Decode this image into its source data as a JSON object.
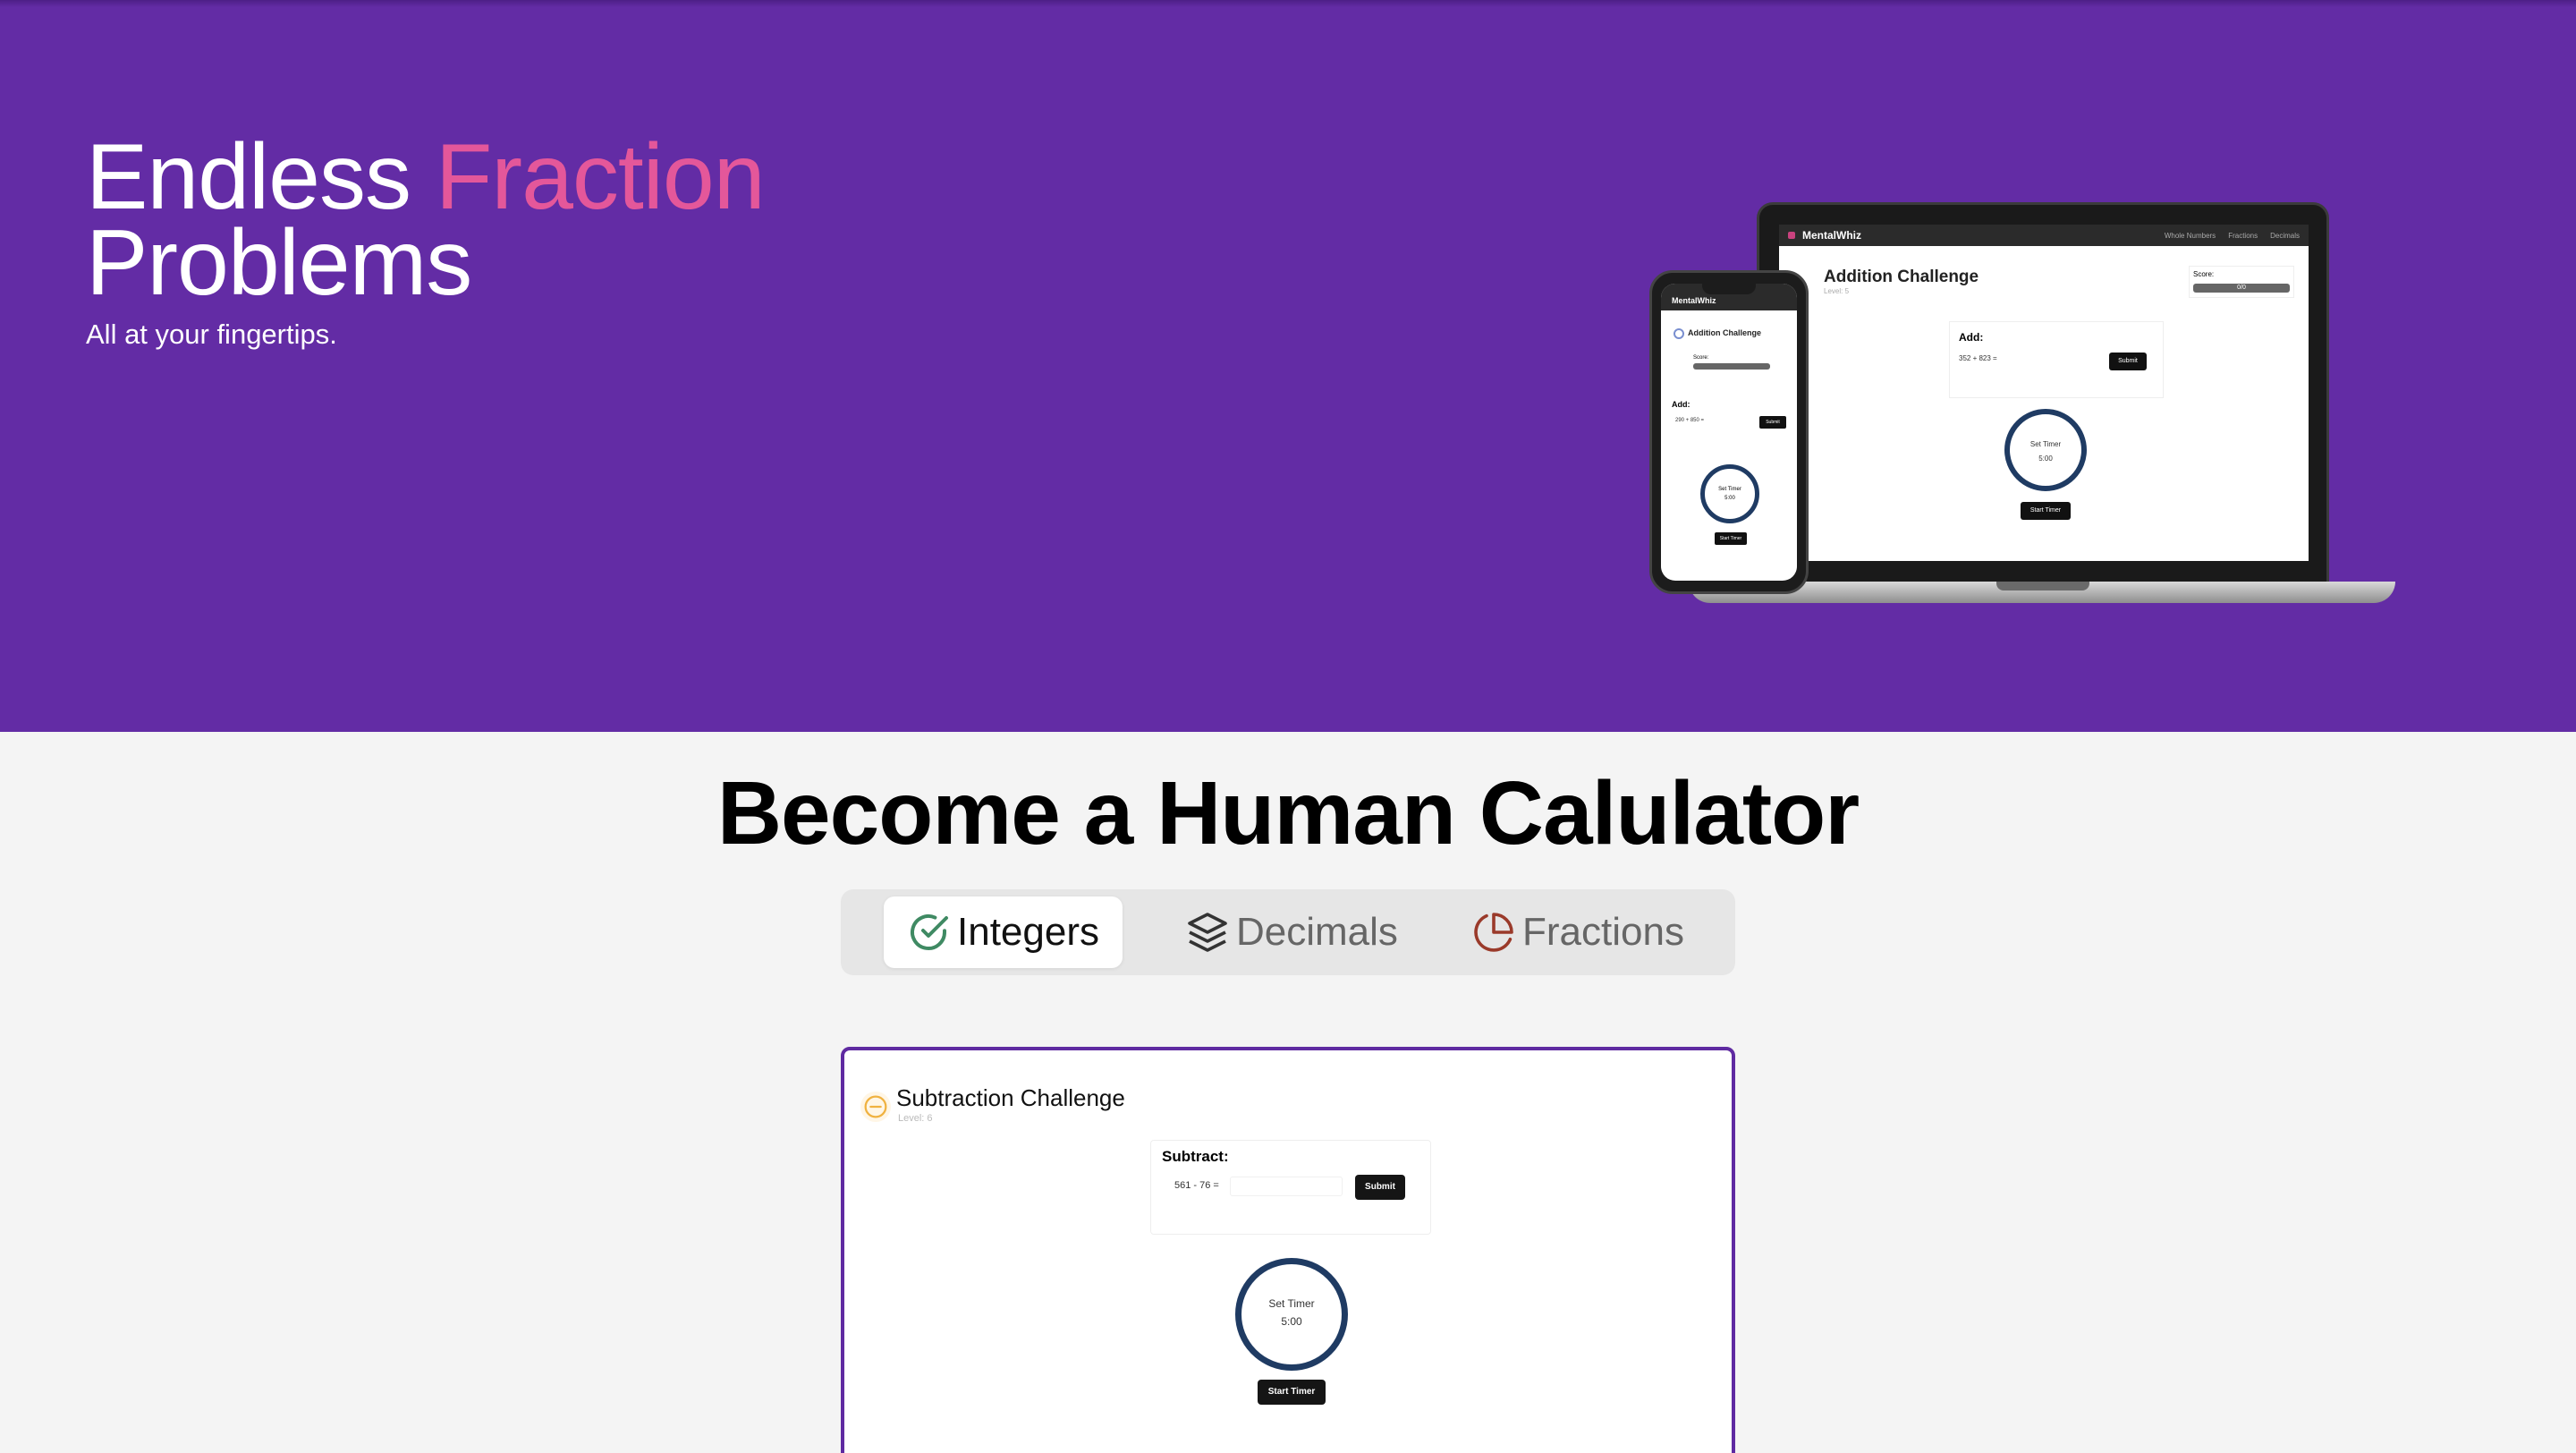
{
  "hero": {
    "title_part1": "Endless",
    "title_accent": "Fraction",
    "title_part2": "Problems",
    "subtitle": "All at your fingertips.",
    "colors": {
      "background": "#632ca5",
      "accent": "#e4579a"
    }
  },
  "laptop_preview": {
    "brand": "MentalWhiz",
    "nav_links": [
      "Whole Numbers",
      "Fractions",
      "Decimals"
    ],
    "title": "Addition Challenge",
    "level": "Level: 5",
    "score_label": "Score:",
    "score_value": "0/0",
    "prompt_label": "Add:",
    "problem": "352 + 823 =",
    "submit_label": "Submit",
    "timer_label": "Set Timer",
    "timer_value": "5:00",
    "start_label": "Start Timer"
  },
  "phone_preview": {
    "brand": "MentalWhiz",
    "title": "Addition Challenge",
    "level": "Level: 5",
    "score_label": "Score:",
    "score_value": "0/0",
    "prompt_label": "Add:",
    "problem": "290 + 850 =",
    "submit_label": "Submit",
    "timer_label": "Set Timer",
    "timer_value": "5:00",
    "start_label": "Start Timer"
  },
  "section": {
    "title": "Become a Human Calulator"
  },
  "tabs": [
    {
      "label": "Integers",
      "icon": "check-circle-icon",
      "active": true,
      "icon_color": "#3f8a63"
    },
    {
      "label": "Decimals",
      "icon": "layers-icon",
      "active": false,
      "icon_color": "#333333"
    },
    {
      "label": "Fractions",
      "icon": "pie-chart-icon",
      "active": false,
      "icon_color": "#9a3a2a"
    }
  ],
  "challenge_card": {
    "title": "Subtraction Challenge",
    "level": "Level: 6",
    "icon": "minus-circle-icon",
    "prompt_label": "Subtract:",
    "problem": "561 - 76 =",
    "input_value": "",
    "submit_label": "Submit",
    "timer_label": "Set Timer",
    "timer_value": "5:00",
    "start_label": "Start Timer",
    "border_color": "#5f2aa1"
  }
}
